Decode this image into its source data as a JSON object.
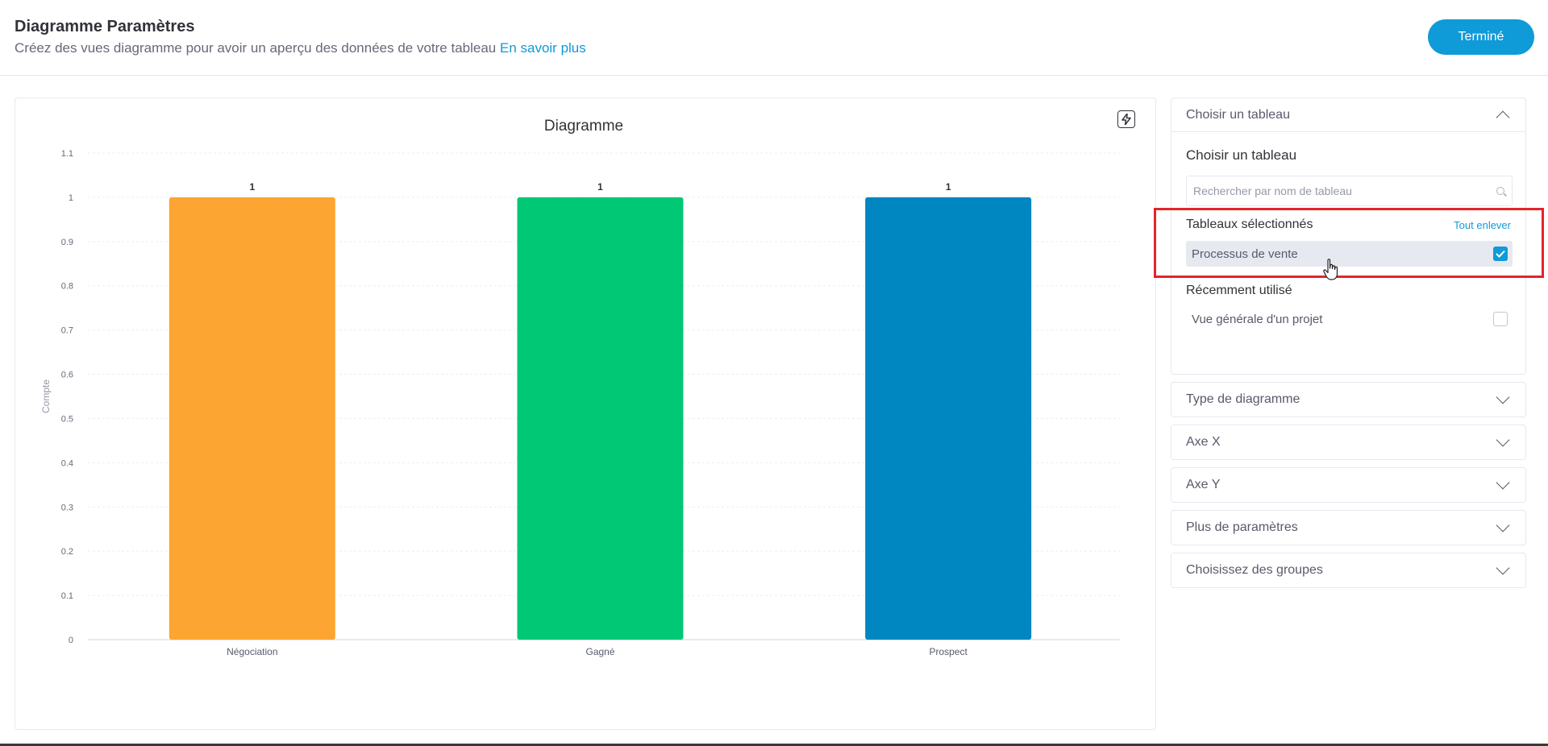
{
  "header": {
    "title": "Diagramme Paramètres",
    "subtitle": "Créez des vues diagramme pour avoir un aperçu des données de votre tableau ",
    "learn_more": "En savoir plus",
    "done_label": "Terminé"
  },
  "chart_data": {
    "type": "bar",
    "title": "Diagramme",
    "xlabel": "",
    "ylabel": "Compte",
    "categories": [
      "Négociation",
      "Gagné",
      "Prospect"
    ],
    "values": [
      1,
      1,
      1
    ],
    "data_labels": [
      "1",
      "1",
      "1"
    ],
    "colors": [
      "#fda532",
      "#00c875",
      "#0086c0"
    ],
    "ylim": [
      0,
      1.1
    ],
    "yticks": [
      "0",
      "0.1",
      "0.2",
      "0.3",
      "0.4",
      "0.5",
      "0.6",
      "0.7",
      "0.8",
      "0.9",
      "1",
      "1.1"
    ],
    "grid": true,
    "legend": "none"
  },
  "panel": {
    "choose_board": {
      "header": "Choisir un tableau",
      "title": "Choisir un tableau",
      "search_placeholder": "Rechercher par nom de tableau",
      "selected_label": "Tableaux sélectionnés",
      "clear_all": "Tout enlever",
      "selected_items": [
        "Processus de vente"
      ],
      "recent_label": "Récemment utilisé",
      "recent_items": [
        "Vue générale d'un projet"
      ]
    },
    "sections": [
      {
        "label": "Type de diagramme"
      },
      {
        "label": "Axe X"
      },
      {
        "label": "Axe Y"
      },
      {
        "label": "Plus de paramètres"
      },
      {
        "label": "Choisissez des groupes"
      }
    ]
  },
  "icons": {
    "bolt": "lightning-icon",
    "search": "search-icon",
    "check": "checkbox-checked-icon"
  }
}
